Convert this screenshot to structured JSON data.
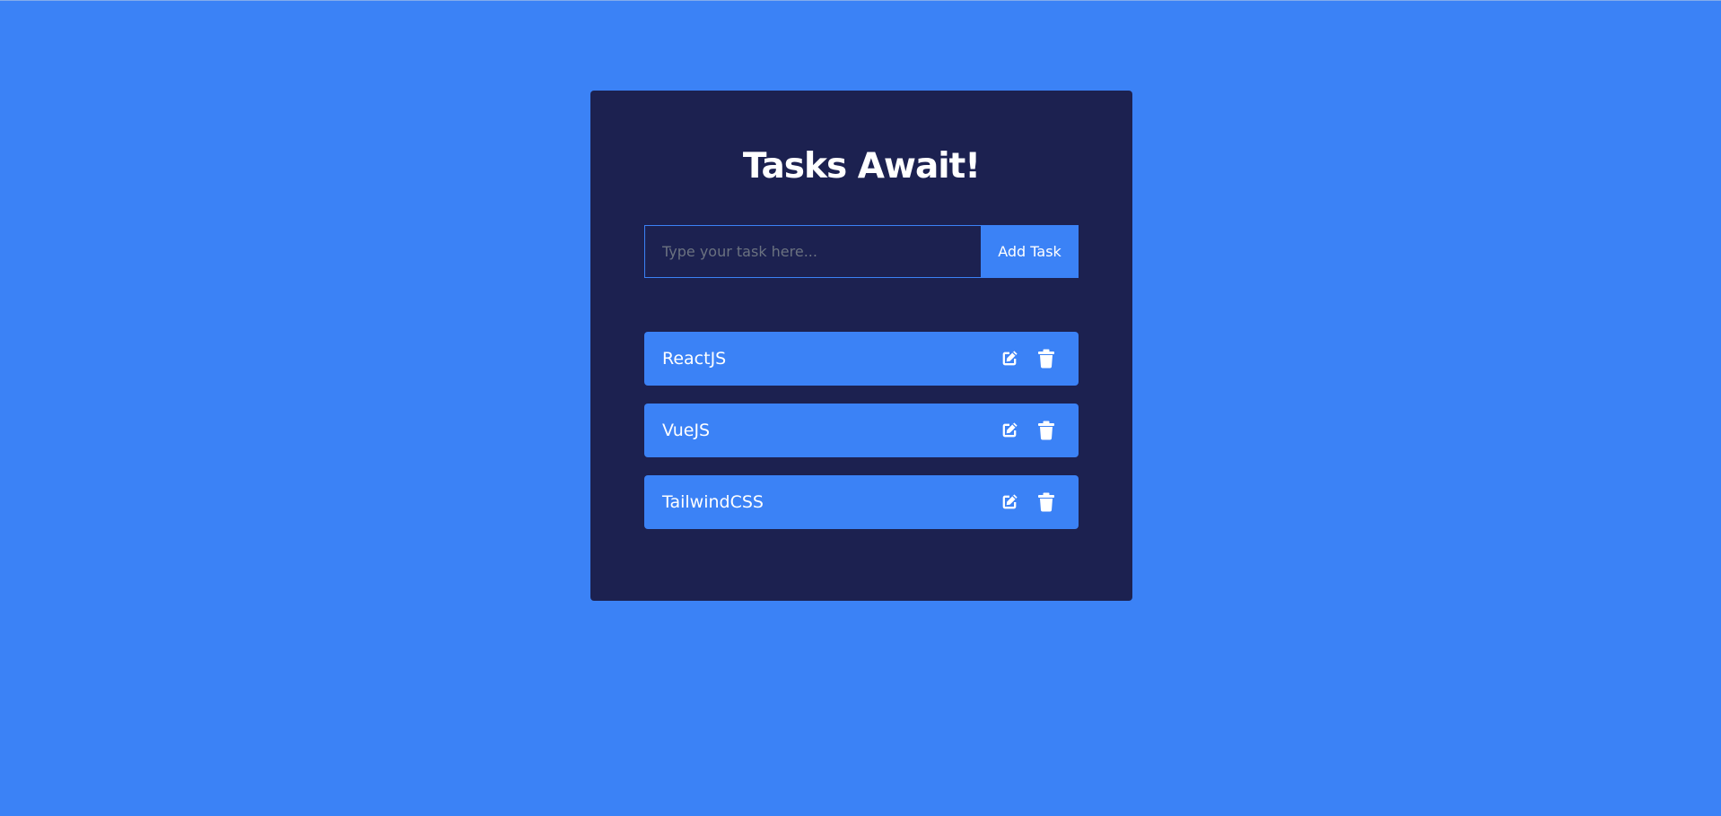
{
  "app": {
    "title": "Tasks Await!"
  },
  "form": {
    "placeholder": "Type your task here...",
    "value": "",
    "add_button_label": "Add Task"
  },
  "tasks": [
    {
      "label": "ReactJS",
      "edit_icon": "edit-icon",
      "delete_icon": "trash-icon"
    },
    {
      "label": "VueJS",
      "edit_icon": "edit-icon",
      "delete_icon": "trash-icon"
    },
    {
      "label": "TailwindCSS",
      "edit_icon": "edit-icon",
      "delete_icon": "trash-icon"
    }
  ],
  "colors": {
    "background": "#3b82f6",
    "card": "#1c2150",
    "accent": "#3b82f6",
    "text": "#ffffff",
    "placeholder": "#6b7280"
  }
}
